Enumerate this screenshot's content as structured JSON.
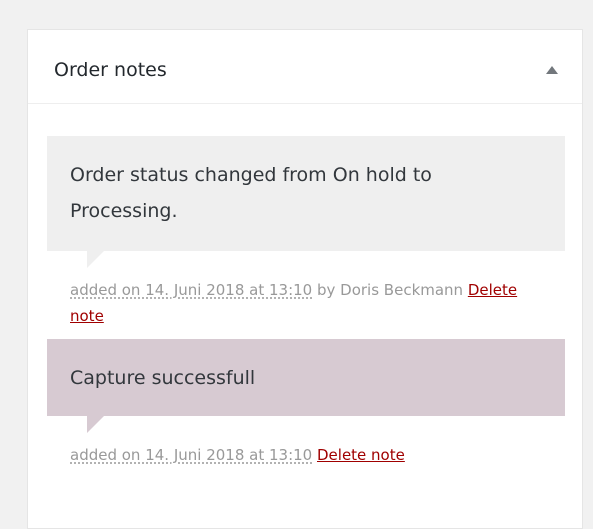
{
  "panel": {
    "title": "Order notes"
  },
  "notes": [
    {
      "type": "system",
      "content": "Order status changed from On hold to Processing.",
      "added_prefix": "added on 14. Juni 2018 at 13:10",
      "author": " by Doris Beckmann ",
      "delete_label": "Delete note"
    },
    {
      "type": "customer",
      "content": "Capture successfull",
      "added_prefix": "added on 14. Juni 2018 at 13:10",
      "author": " ",
      "delete_label": "Delete note"
    }
  ],
  "icons": {
    "toggle": "caret-up-icon"
  },
  "colors": {
    "system_note_bg": "#efefef",
    "customer_note_bg": "#d7cad2",
    "delete_link": "#a00000",
    "meta_text": "#999999"
  }
}
